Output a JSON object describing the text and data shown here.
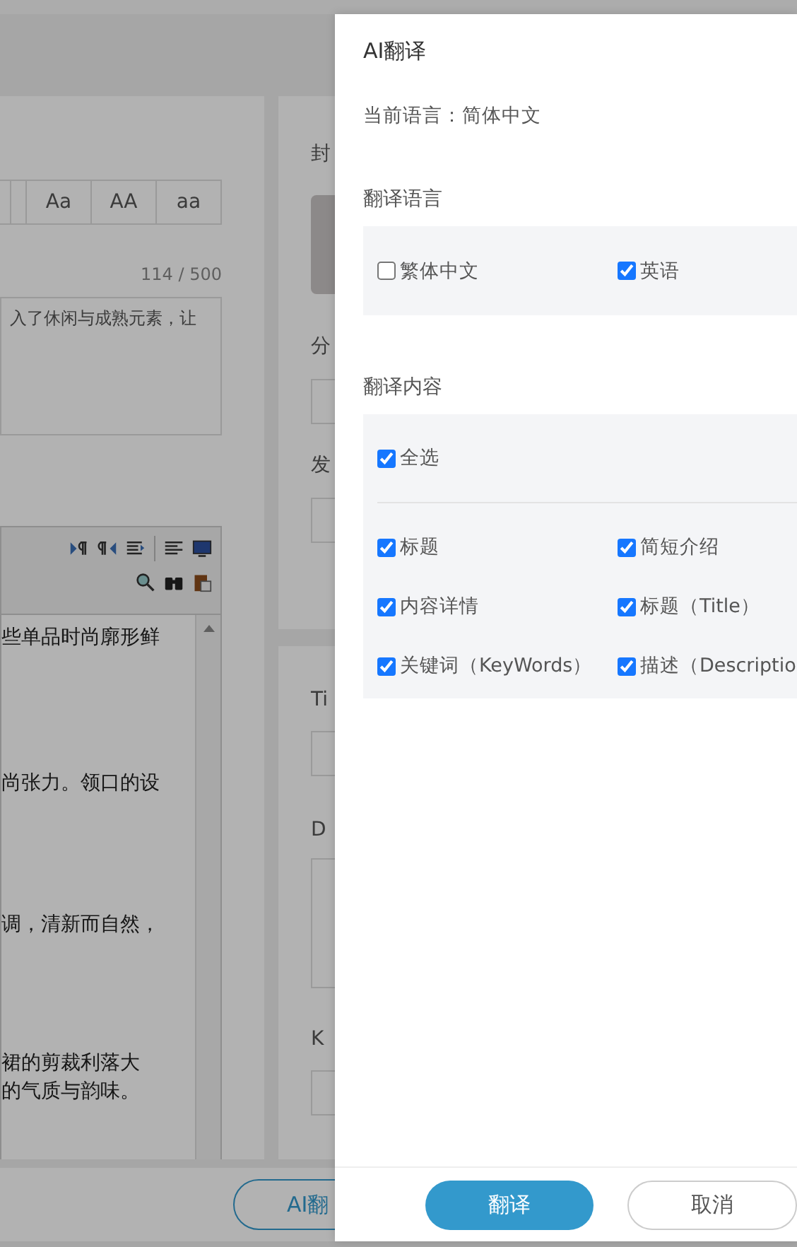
{
  "background_page": {
    "case_buttons": [
      "Aa",
      "AA",
      "aa"
    ],
    "char_count": "114 / 500",
    "summary_text": "入了休闲与成熟元素，让",
    "editor_paragraphs": [
      [
        "些单品时尚廓形鲜"
      ],
      [
        "尚张力。领口的设"
      ],
      [
        "调，清新而自然，"
      ],
      [
        "裙的剪裁利落大",
        "的气质与韵味。"
      ]
    ],
    "side_cards": [
      [
        {
          "label": "封",
          "kind": "image"
        },
        {
          "label": "分",
          "kind": "field"
        },
        {
          "label": "发",
          "kind": "field"
        }
      ],
      [
        {
          "label": "Ti",
          "kind": "field"
        },
        {
          "label": "D",
          "kind": "textarea"
        },
        {
          "label": "K",
          "kind": "field"
        }
      ]
    ],
    "ai_translate_button": "AI翻"
  },
  "drawer": {
    "title": "AI翻译",
    "current_language": "当前语言：简体中文",
    "language_section": {
      "heading": "翻译语言",
      "options": [
        {
          "label": "繁体中文",
          "checked": false
        },
        {
          "label": "英语",
          "checked": true
        }
      ]
    },
    "content_section": {
      "heading": "翻译内容",
      "select_all": {
        "label": "全选",
        "checked": true
      },
      "options": [
        {
          "label": "标题",
          "checked": true
        },
        {
          "label": "简短介绍",
          "checked": true
        },
        {
          "label": "内容详情",
          "checked": true
        },
        {
          "label": "标题（Title）",
          "checked": true
        },
        {
          "label": "关键词（KeyWords）",
          "checked": true
        },
        {
          "label": "描述（Descriptio",
          "checked": true
        }
      ]
    },
    "buttons": {
      "primary": "翻译",
      "cancel": "取消"
    }
  }
}
